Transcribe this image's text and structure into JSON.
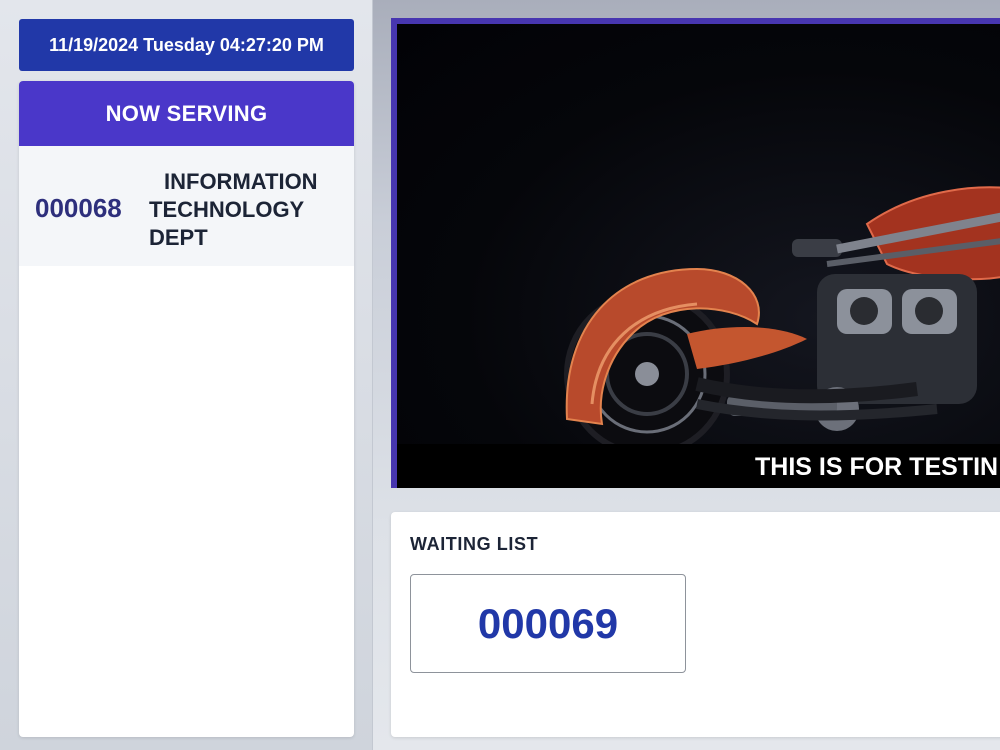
{
  "datetime": "11/19/2024 Tuesday 04:27:20 PM",
  "now_serving": {
    "title": "NOW SERVING",
    "entries": [
      {
        "number": "000068",
        "department": "INFORMATION TECHNOLOGY DEPT"
      }
    ]
  },
  "video": {
    "ticker_text": "THIS IS FOR TESTIN"
  },
  "waiting_list": {
    "title": "WAITING LIST",
    "items": [
      {
        "number": "000069"
      }
    ]
  },
  "colors": {
    "accent_blue": "#2138a8",
    "header_purple": "#4a37c9",
    "frame_purple": "#4736b0",
    "serving_number": "#2e2f7c"
  }
}
